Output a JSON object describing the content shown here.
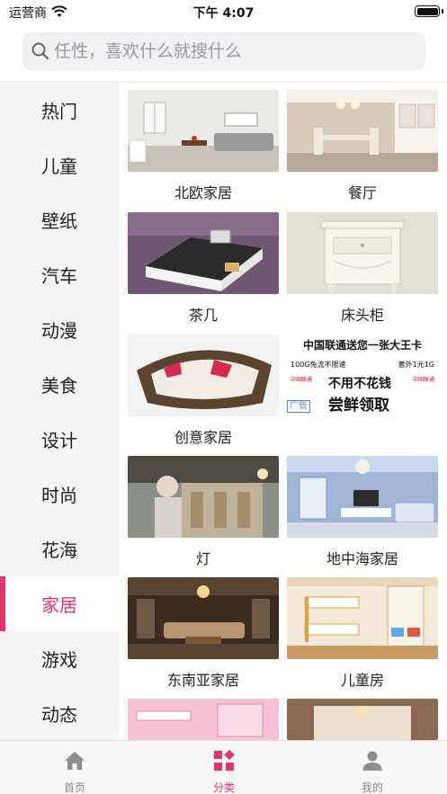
{
  "status_bar": {
    "carrier": "运营商",
    "time": "下午 4:07",
    "battery_level": 1.0
  },
  "search": {
    "placeholder": "任性，喜欢什么就搜什么"
  },
  "sidebar": {
    "items": [
      {
        "label": "热门"
      },
      {
        "label": "儿童"
      },
      {
        "label": "壁纸"
      },
      {
        "label": "汽车"
      },
      {
        "label": "动漫"
      },
      {
        "label": "美食"
      },
      {
        "label": "设计"
      },
      {
        "label": "时尚"
      },
      {
        "label": "花海"
      },
      {
        "label": "家居",
        "active": true
      },
      {
        "label": "游戏"
      },
      {
        "label": "动态"
      }
    ]
  },
  "grid": {
    "items": [
      {
        "label": "北欧家居"
      },
      {
        "label": "餐厅"
      },
      {
        "label": "茶几"
      },
      {
        "label": "床头柜"
      },
      {
        "label": "创意家居"
      },
      {
        "label": "灯"
      },
      {
        "label": "地中海家居"
      },
      {
        "label": "东南亚家居"
      },
      {
        "label": "儿童房"
      }
    ]
  },
  "ad": {
    "title": "中国联通送您一张大王卡",
    "line_left": "100G免流不限速",
    "line_right": "套外1元1G",
    "logo_text": "中国联通",
    "headline": "不用不花钱",
    "subheadline": "尝鲜领取",
    "badge": "广告"
  },
  "tabbar": {
    "items": [
      {
        "label": "首页",
        "icon": "home-icon"
      },
      {
        "label": "分类",
        "icon": "category-icon",
        "active": true
      },
      {
        "label": "我的",
        "icon": "profile-icon"
      }
    ]
  },
  "colors": {
    "accent": "#e8336a",
    "sidebar_bg": "#f5f5f5",
    "search_bg": "#f1f1f3"
  }
}
